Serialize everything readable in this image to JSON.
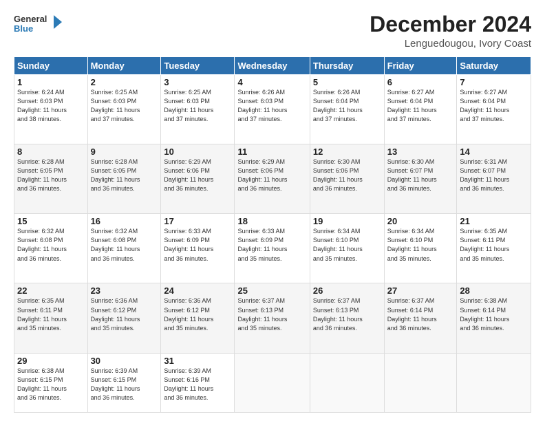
{
  "logo": {
    "general": "General",
    "blue": "Blue"
  },
  "header": {
    "title": "December 2024",
    "subtitle": "Lenguedougou, Ivory Coast"
  },
  "weekdays": [
    "Sunday",
    "Monday",
    "Tuesday",
    "Wednesday",
    "Thursday",
    "Friday",
    "Saturday"
  ],
  "weeks": [
    [
      {
        "day": "1",
        "info": "Sunrise: 6:24 AM\nSunset: 6:03 PM\nDaylight: 11 hours\nand 38 minutes."
      },
      {
        "day": "2",
        "info": "Sunrise: 6:25 AM\nSunset: 6:03 PM\nDaylight: 11 hours\nand 37 minutes."
      },
      {
        "day": "3",
        "info": "Sunrise: 6:25 AM\nSunset: 6:03 PM\nDaylight: 11 hours\nand 37 minutes."
      },
      {
        "day": "4",
        "info": "Sunrise: 6:26 AM\nSunset: 6:03 PM\nDaylight: 11 hours\nand 37 minutes."
      },
      {
        "day": "5",
        "info": "Sunrise: 6:26 AM\nSunset: 6:04 PM\nDaylight: 11 hours\nand 37 minutes."
      },
      {
        "day": "6",
        "info": "Sunrise: 6:27 AM\nSunset: 6:04 PM\nDaylight: 11 hours\nand 37 minutes."
      },
      {
        "day": "7",
        "info": "Sunrise: 6:27 AM\nSunset: 6:04 PM\nDaylight: 11 hours\nand 37 minutes."
      }
    ],
    [
      {
        "day": "8",
        "info": "Sunrise: 6:28 AM\nSunset: 6:05 PM\nDaylight: 11 hours\nand 36 minutes."
      },
      {
        "day": "9",
        "info": "Sunrise: 6:28 AM\nSunset: 6:05 PM\nDaylight: 11 hours\nand 36 minutes."
      },
      {
        "day": "10",
        "info": "Sunrise: 6:29 AM\nSunset: 6:06 PM\nDaylight: 11 hours\nand 36 minutes."
      },
      {
        "day": "11",
        "info": "Sunrise: 6:29 AM\nSunset: 6:06 PM\nDaylight: 11 hours\nand 36 minutes."
      },
      {
        "day": "12",
        "info": "Sunrise: 6:30 AM\nSunset: 6:06 PM\nDaylight: 11 hours\nand 36 minutes."
      },
      {
        "day": "13",
        "info": "Sunrise: 6:30 AM\nSunset: 6:07 PM\nDaylight: 11 hours\nand 36 minutes."
      },
      {
        "day": "14",
        "info": "Sunrise: 6:31 AM\nSunset: 6:07 PM\nDaylight: 11 hours\nand 36 minutes."
      }
    ],
    [
      {
        "day": "15",
        "info": "Sunrise: 6:32 AM\nSunset: 6:08 PM\nDaylight: 11 hours\nand 36 minutes."
      },
      {
        "day": "16",
        "info": "Sunrise: 6:32 AM\nSunset: 6:08 PM\nDaylight: 11 hours\nand 36 minutes."
      },
      {
        "day": "17",
        "info": "Sunrise: 6:33 AM\nSunset: 6:09 PM\nDaylight: 11 hours\nand 36 minutes."
      },
      {
        "day": "18",
        "info": "Sunrise: 6:33 AM\nSunset: 6:09 PM\nDaylight: 11 hours\nand 35 minutes."
      },
      {
        "day": "19",
        "info": "Sunrise: 6:34 AM\nSunset: 6:10 PM\nDaylight: 11 hours\nand 35 minutes."
      },
      {
        "day": "20",
        "info": "Sunrise: 6:34 AM\nSunset: 6:10 PM\nDaylight: 11 hours\nand 35 minutes."
      },
      {
        "day": "21",
        "info": "Sunrise: 6:35 AM\nSunset: 6:11 PM\nDaylight: 11 hours\nand 35 minutes."
      }
    ],
    [
      {
        "day": "22",
        "info": "Sunrise: 6:35 AM\nSunset: 6:11 PM\nDaylight: 11 hours\nand 35 minutes."
      },
      {
        "day": "23",
        "info": "Sunrise: 6:36 AM\nSunset: 6:12 PM\nDaylight: 11 hours\nand 35 minutes."
      },
      {
        "day": "24",
        "info": "Sunrise: 6:36 AM\nSunset: 6:12 PM\nDaylight: 11 hours\nand 35 minutes."
      },
      {
        "day": "25",
        "info": "Sunrise: 6:37 AM\nSunset: 6:13 PM\nDaylight: 11 hours\nand 35 minutes."
      },
      {
        "day": "26",
        "info": "Sunrise: 6:37 AM\nSunset: 6:13 PM\nDaylight: 11 hours\nand 36 minutes."
      },
      {
        "day": "27",
        "info": "Sunrise: 6:37 AM\nSunset: 6:14 PM\nDaylight: 11 hours\nand 36 minutes."
      },
      {
        "day": "28",
        "info": "Sunrise: 6:38 AM\nSunset: 6:14 PM\nDaylight: 11 hours\nand 36 minutes."
      }
    ],
    [
      {
        "day": "29",
        "info": "Sunrise: 6:38 AM\nSunset: 6:15 PM\nDaylight: 11 hours\nand 36 minutes."
      },
      {
        "day": "30",
        "info": "Sunrise: 6:39 AM\nSunset: 6:15 PM\nDaylight: 11 hours\nand 36 minutes."
      },
      {
        "day": "31",
        "info": "Sunrise: 6:39 AM\nSunset: 6:16 PM\nDaylight: 11 hours\nand 36 minutes."
      },
      {
        "day": "",
        "info": ""
      },
      {
        "day": "",
        "info": ""
      },
      {
        "day": "",
        "info": ""
      },
      {
        "day": "",
        "info": ""
      }
    ]
  ]
}
